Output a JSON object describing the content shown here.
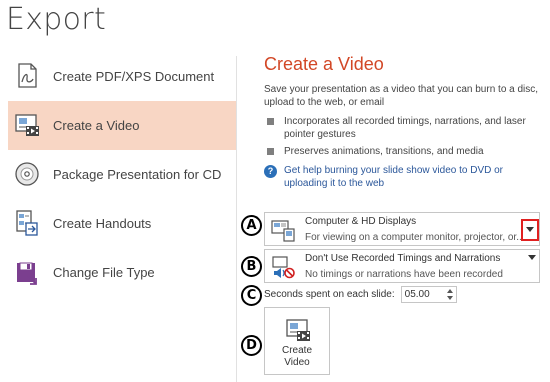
{
  "page_title": "Export",
  "nav": {
    "items": [
      {
        "label": "Create PDF/XPS Document",
        "icon": "pdf-document-icon"
      },
      {
        "label": "Create a Video",
        "icon": "video-icon"
      },
      {
        "label": "Package Presentation for CD",
        "icon": "cd-icon"
      },
      {
        "label": "Create Handouts",
        "icon": "handouts-icon"
      },
      {
        "label": "Change File Type",
        "icon": "file-type-icon"
      }
    ],
    "selected_index": 1
  },
  "main": {
    "title": "Create a Video",
    "description": "Save your presentation as a video that you can burn to a disc, upload to the web, or email",
    "bullets": [
      "Incorporates all recorded timings, narrations, and laser pointer gestures",
      "Preserves animations, transitions, and media"
    ],
    "help_link": "Get help burning your slide show video to DVD or uploading it to the web",
    "quality_dropdown": {
      "selected": "Computer & HD Displays",
      "description": "For viewing on a computer monitor, projector, or..."
    },
    "timings_dropdown": {
      "selected": "Don't Use Recorded Timings and Narrations",
      "description": "No timings or narrations have been recorded"
    },
    "seconds_label": "Seconds spent on each slide:",
    "seconds_value": "05.00",
    "create_button_line1": "Create",
    "create_button_line2": "Video"
  },
  "callouts": {
    "a": "A",
    "b": "B",
    "c": "C",
    "d": "D"
  },
  "colors": {
    "accent": "#d24726",
    "selected_bg": "#f8d6c4",
    "link": "#2b579a",
    "callout_highlight": "#e02020"
  }
}
